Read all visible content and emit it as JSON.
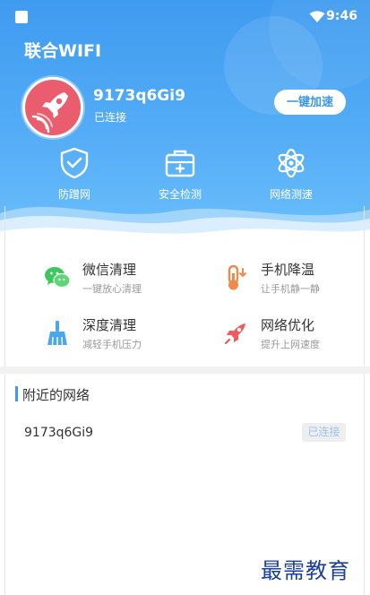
{
  "status_bar": {
    "time": "9:46"
  },
  "app": {
    "title": "联合WIFI"
  },
  "connection": {
    "ssid": "9173q6Gi9",
    "status": "已连接",
    "speed_button": "一键加速"
  },
  "quick_actions": [
    {
      "label": "防蹭网",
      "icon": "shield-check-icon"
    },
    {
      "label": "安全检测",
      "icon": "toolbox-icon"
    },
    {
      "label": "网络测速",
      "icon": "atom-icon"
    }
  ],
  "tools": [
    {
      "title": "微信清理",
      "subtitle": "一键放心清理",
      "icon": "wechat-icon",
      "color": "#3dc75c"
    },
    {
      "title": "手机降温",
      "subtitle": "让手机静一静",
      "icon": "thermometer-icon",
      "color": "#f08a4b"
    },
    {
      "title": "深度清理",
      "subtitle": "减轻手机压力",
      "icon": "broom-icon",
      "color": "#4aa8e8"
    },
    {
      "title": "网络优化",
      "subtitle": "提升上网速度",
      "icon": "rocket-icon",
      "color": "#ef5b5b"
    }
  ],
  "nearby": {
    "title": "附近的网络",
    "networks": [
      {
        "name": "9173q6Gi9",
        "badge": "已连接"
      }
    ]
  },
  "watermark": "最需教育",
  "colors": {
    "header_blue": "#3f9bf0",
    "avatar_red": "#e95d6e",
    "accent": "#3b97ef"
  }
}
